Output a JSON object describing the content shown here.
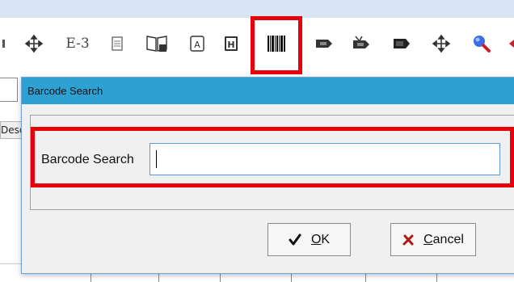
{
  "toolbar": {
    "items": [
      {
        "name": "move-icon"
      },
      {
        "name": "e3-tool",
        "text": "E-3"
      },
      {
        "name": "document-icon"
      },
      {
        "name": "book-icon"
      },
      {
        "name": "report-a-icon"
      },
      {
        "name": "h-box-icon"
      },
      {
        "name": "barcode-icon"
      },
      {
        "name": "tag-icon"
      },
      {
        "name": "tag-edit-icon"
      },
      {
        "name": "tag-dark-icon"
      },
      {
        "name": "move-icon-2"
      },
      {
        "name": "search-icon"
      }
    ],
    "highlight_color": "#e8000b"
  },
  "background": {
    "column_header_fragment": "Desc"
  },
  "dialog": {
    "title": "Barcode Search",
    "title_bar_color": "#2ea1d3",
    "field_label": "Barcode Search",
    "field_value": "",
    "ok": {
      "icon": "checkmark-icon",
      "mnemonic": "O",
      "rest": "K"
    },
    "cancel": {
      "icon": "x-icon",
      "mnemonic": "C",
      "rest": "ancel"
    }
  }
}
